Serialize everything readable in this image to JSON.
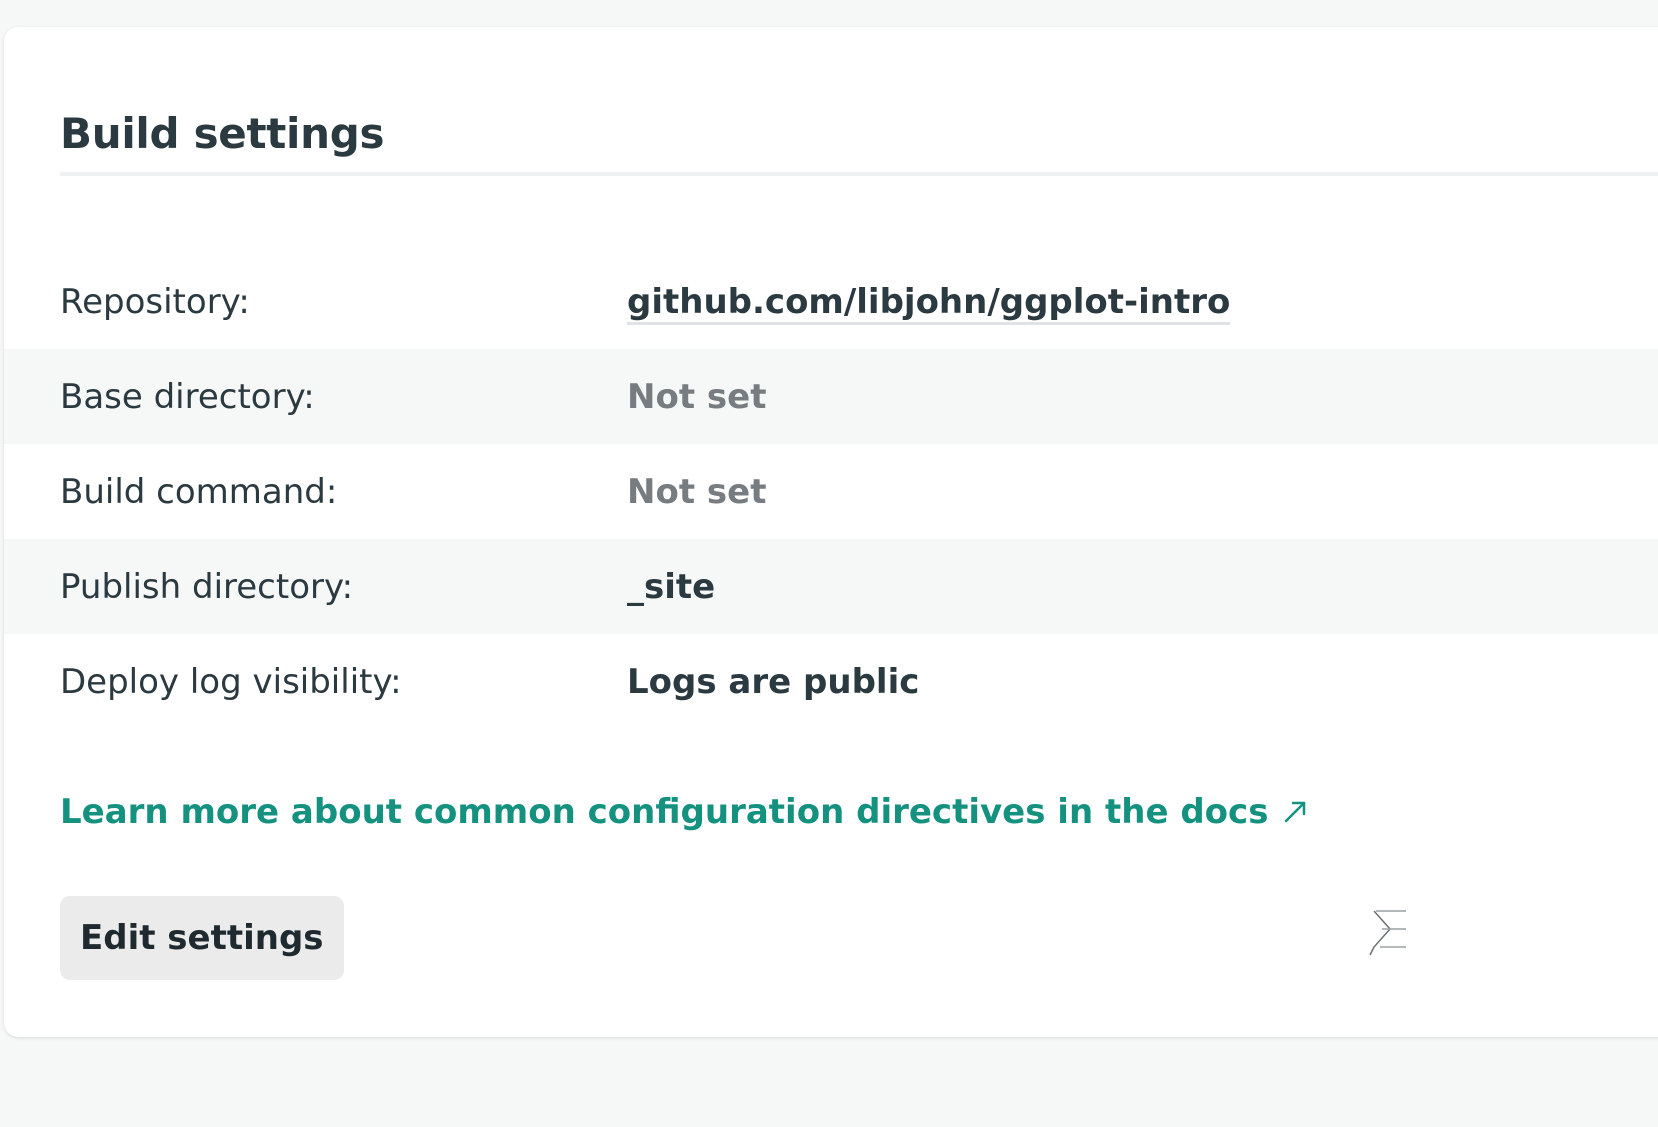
{
  "card": {
    "title": "Build settings"
  },
  "settings": [
    {
      "label": "Repository:",
      "value": "github.com/libjohn/ggplot-intro",
      "kind": "link"
    },
    {
      "label": "Base directory:",
      "value": "Not set",
      "kind": "muted"
    },
    {
      "label": "Build command:",
      "value": "Not set",
      "kind": "muted"
    },
    {
      "label": "Publish directory:",
      "value": "_site",
      "kind": "dark"
    },
    {
      "label": "Deploy log visibility:",
      "value": "Logs are public",
      "kind": "dark"
    }
  ],
  "docs_link": {
    "text": "Learn more about common configuration directives in the docs",
    "icon": "external-arrow-icon"
  },
  "actions": {
    "edit_label": "Edit settings"
  },
  "colors": {
    "accent": "#14927f",
    "text_dark": "#2b3940",
    "text_muted": "#767c80",
    "row_shade": "#f6f8f8",
    "button_bg": "#ebebeb"
  }
}
